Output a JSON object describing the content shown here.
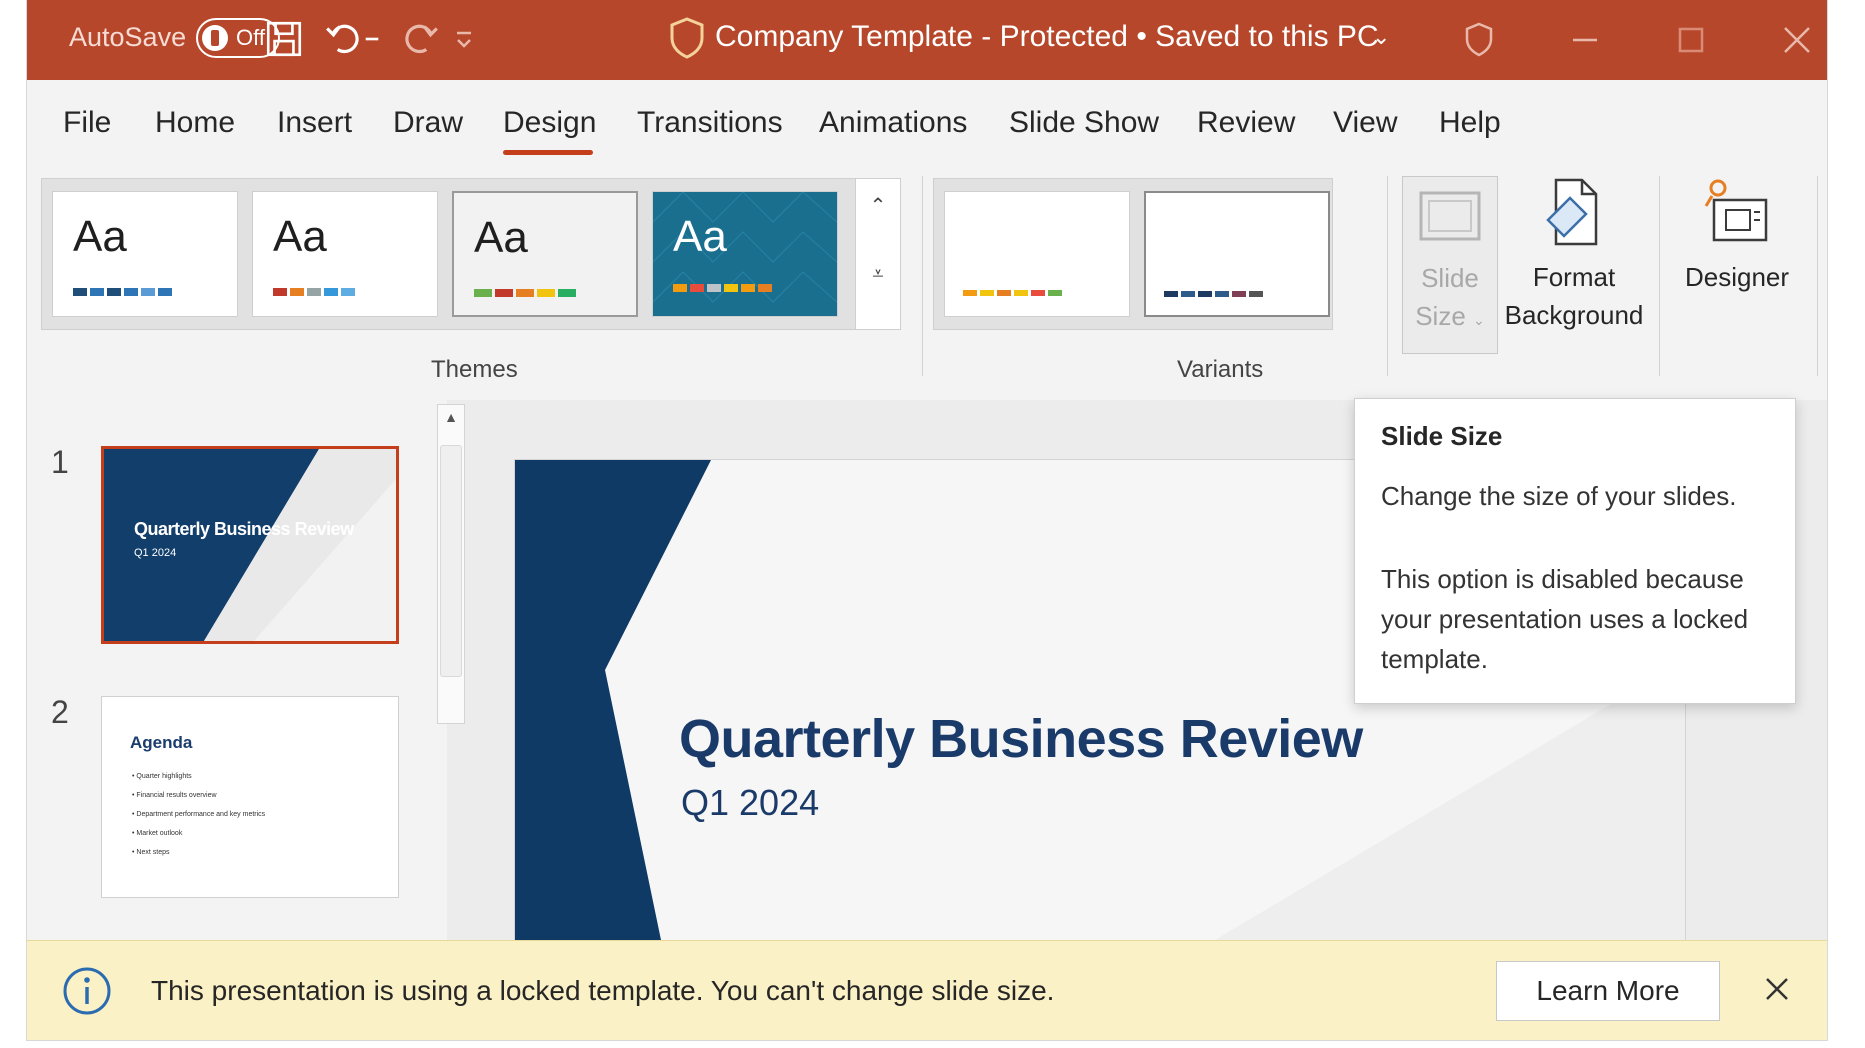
{
  "titlebar": {
    "autosave_label": "AutoSave",
    "autosave_state": "Off",
    "document_title": "Company Template - Protected • Saved to this PC",
    "background_color": "#b7472a",
    "icons": [
      "save-icon",
      "undo-icon",
      "redo-icon",
      "customize-qat-icon",
      "shield-icon",
      "minimize-icon",
      "maximize-icon",
      "close-icon"
    ]
  },
  "tabs": [
    {
      "label": "File"
    },
    {
      "label": "Home"
    },
    {
      "label": "Insert"
    },
    {
      "label": "Draw"
    },
    {
      "label": "Design",
      "active": true
    },
    {
      "label": "Transitions"
    },
    {
      "label": "Animations"
    },
    {
      "label": "Slide Show"
    },
    {
      "label": "Review"
    },
    {
      "label": "View"
    },
    {
      "label": "Help"
    }
  ],
  "ribbon": {
    "themes_label": "Themes",
    "variants_label": "Variants",
    "theme_sample_text": "Aa",
    "slide_size": {
      "line1": "Slide",
      "line2": "Size",
      "disabled": true
    },
    "format_background": {
      "line1": "Format",
      "line2": "Background"
    },
    "designer": {
      "label": "Designer"
    }
  },
  "slides": {
    "thumb1": {
      "number": "1",
      "title": "Quarterly Business Review",
      "subtitle": "Q1 2024"
    },
    "thumb2": {
      "number": "2",
      "title": "Agenda",
      "bullets": [
        "Quarter highlights",
        "Financial results overview",
        "Department performance and key metrics",
        "Market outlook",
        "Next steps"
      ]
    }
  },
  "main_slide": {
    "title": "Quarterly Business Review",
    "subtitle": "Q1 2024",
    "accent_color": "#0f3a66"
  },
  "tooltip": {
    "title": "Slide Size",
    "line1": "Change the size of your slides.",
    "body": "This option is disabled because your presentation uses a locked template."
  },
  "message_bar": {
    "text": "This presentation is using a locked template. You can't change slide size.",
    "button_label": "Learn More",
    "background_color": "#fbf1c6"
  }
}
